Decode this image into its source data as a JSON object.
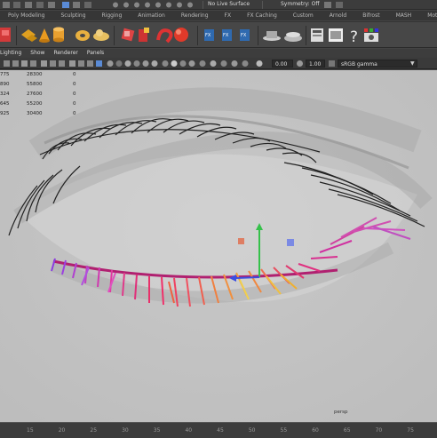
{
  "status_line": {
    "live_surface": "No Live Surface",
    "symmetry": "Symmetry: Off"
  },
  "shelf_tabs": [
    "Poly Modeling",
    "Sculpting",
    "Rigging",
    "Animation",
    "Rendering",
    "FX",
    "FX Caching",
    "Custom",
    "Arnold",
    "Bifrost",
    "MASH",
    "Motion"
  ],
  "panel_menu": [
    "Lighting",
    "Show",
    "Renderer",
    "Panels"
  ],
  "panel_toolbar": {
    "exposure": "0.00",
    "gamma": "1.00",
    "color_space": "sRGB gamma"
  },
  "hud_rows": [
    [
      "775",
      "28300",
      "0"
    ],
    [
      "890",
      "55800",
      "0"
    ],
    [
      "324",
      "27600",
      "0"
    ],
    [
      "645",
      "55200",
      "0"
    ],
    [
      "925",
      "30400",
      "0"
    ]
  ],
  "camera_label": "persp",
  "timeline_ticks": [
    "15",
    "20",
    "25",
    "30",
    "35",
    "40",
    "45",
    "50",
    "55",
    "60",
    "65",
    "70",
    "75"
  ],
  "icons": {
    "shelf": [
      "poly-cube-icon",
      "poly-plane-icon",
      "poly-cone-icon",
      "poly-cylinder-icon",
      "poly-torus-icon",
      "move-tool-icon",
      "extrude-icon",
      "bend-icon",
      "sphere-icon",
      "fx-icon",
      "render-icon",
      "help-icon",
      "camera-icon"
    ]
  },
  "colors": {
    "viewport_bg": "#cbcbcb",
    "ui_dark": "#3c3c3c",
    "lash_pink": "#e0246e",
    "manip_green": "#35c14a",
    "manip_blue": "#3a4ee0",
    "manip_red": "#e05030"
  }
}
